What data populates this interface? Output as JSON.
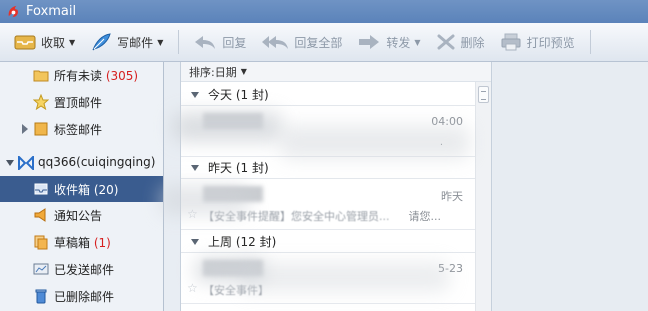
{
  "app": {
    "title": "Foxmail"
  },
  "toolbar": {
    "receive": "收取",
    "compose": "写邮件",
    "reply": "回复",
    "reply_all": "回复全部",
    "forward": "转发",
    "delete": "删除",
    "print_preview": "打印预览"
  },
  "sidebar": {
    "unread_label": "所有未读",
    "unread_count": "(305)",
    "pinned_label": "置顶邮件",
    "tagged_label": "标签邮件",
    "account_label": "qq366(cuiqingqing)",
    "inbox_label": "收件箱",
    "inbox_count": "(20)",
    "notice_label": "通知公告",
    "drafts_label": "草稿箱",
    "drafts_count": "(1)",
    "sent_label": "已发送邮件",
    "deleted_label": "已删除邮件"
  },
  "maillist": {
    "sort_label": "排序:日期",
    "groups": [
      {
        "label": "今天 (1 封)"
      },
      {
        "label": "昨天 (1 封)"
      },
      {
        "label": "上周 (12 封)"
      }
    ],
    "mails": [
      {
        "time": "04:00",
        "preview": "",
        "preview_tail": ""
      },
      {
        "time": "昨天",
        "preview": "【安全事件提醒】您安全中心管理员...",
        "preview_tail": "请您..."
      },
      {
        "time": "5-23",
        "preview": "【安全事件】",
        "preview_tail": ""
      }
    ]
  },
  "colors": {
    "titlebar": "#5b83ba",
    "selected": "#3a5c8f",
    "count_red": "#d61f1f"
  }
}
